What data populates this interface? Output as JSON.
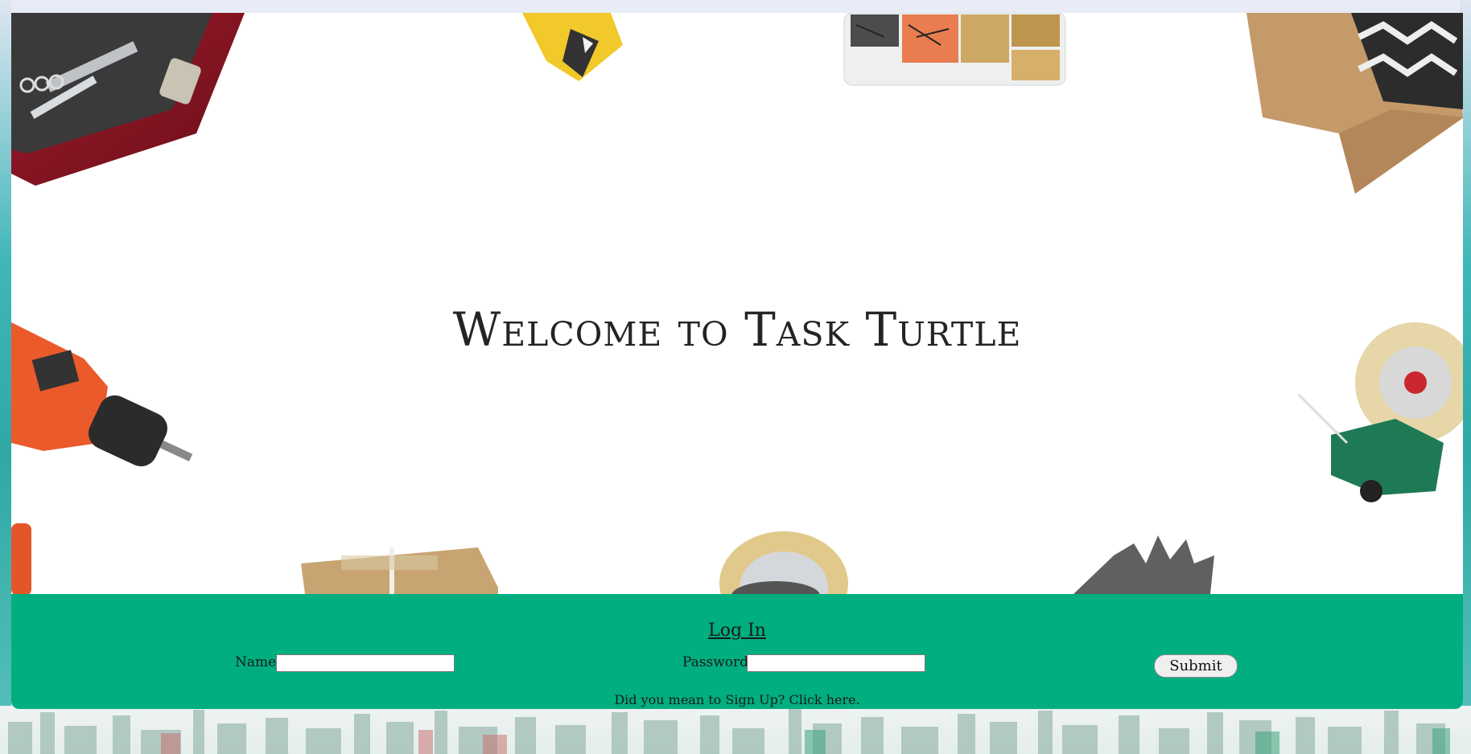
{
  "hero": {
    "title": "Welcome to Task Turtle"
  },
  "login": {
    "title": "Log In",
    "name_label": "Name:",
    "name_value": "",
    "password_label": "Password:",
    "password_value": "",
    "submit_label": "Submit",
    "signup_text": "Did you mean to Sign Up? Click here."
  },
  "colors": {
    "login_band": "#00ae80",
    "title_text": "#242424",
    "card_bg": "#ffffff"
  },
  "icons": [
    "toolbox-image",
    "level-tool-image",
    "screws-box-image",
    "cardboard-box-image",
    "drill-image",
    "tape-dispenser-image",
    "parcel-image",
    "tape-roll-image",
    "glove-image",
    "city-skyline-image"
  ]
}
